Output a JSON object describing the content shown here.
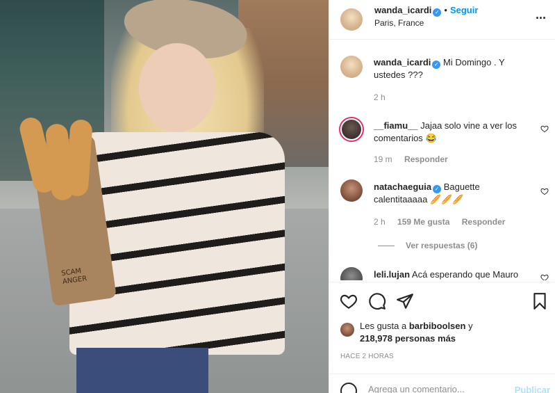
{
  "post": {
    "author": "wanda_icardi",
    "follow_label": "Seguir",
    "dot": "•",
    "location": "Paris, France",
    "more_icon": "more-options-icon"
  },
  "photo": {
    "bag_text_1": "SCAM",
    "bag_text_2": "ANGER"
  },
  "caption": {
    "author": "wanda_icardi",
    "text": "Mi Domingo . Y ustedes ???",
    "time": "2 h"
  },
  "comments": [
    {
      "author": "__fiamu__",
      "text": "Jajaa solo vine a ver los comentarios",
      "emoji": "😂",
      "time": "19 m",
      "likes": "",
      "reply": "Responder"
    },
    {
      "author": "natachaeguia",
      "text": "Baguette calentitaaaaa",
      "emoji": "🥖🥖🥖",
      "time": "2 h",
      "likes": "159 Me gusta",
      "reply": "Responder",
      "view_replies": "Ver respuestas (6)"
    },
    {
      "author": "leli.lujan",
      "text": "Acá esperando que Mauro"
    }
  ],
  "likes": {
    "prefix": "Les gusta a",
    "user": "barbiboolsen",
    "join": "y",
    "count": "218,978 personas más"
  },
  "time_ago": "HACE 2 HORAS",
  "add_comment": {
    "placeholder": "Agrega un comentario...",
    "publish": "Publicar"
  }
}
